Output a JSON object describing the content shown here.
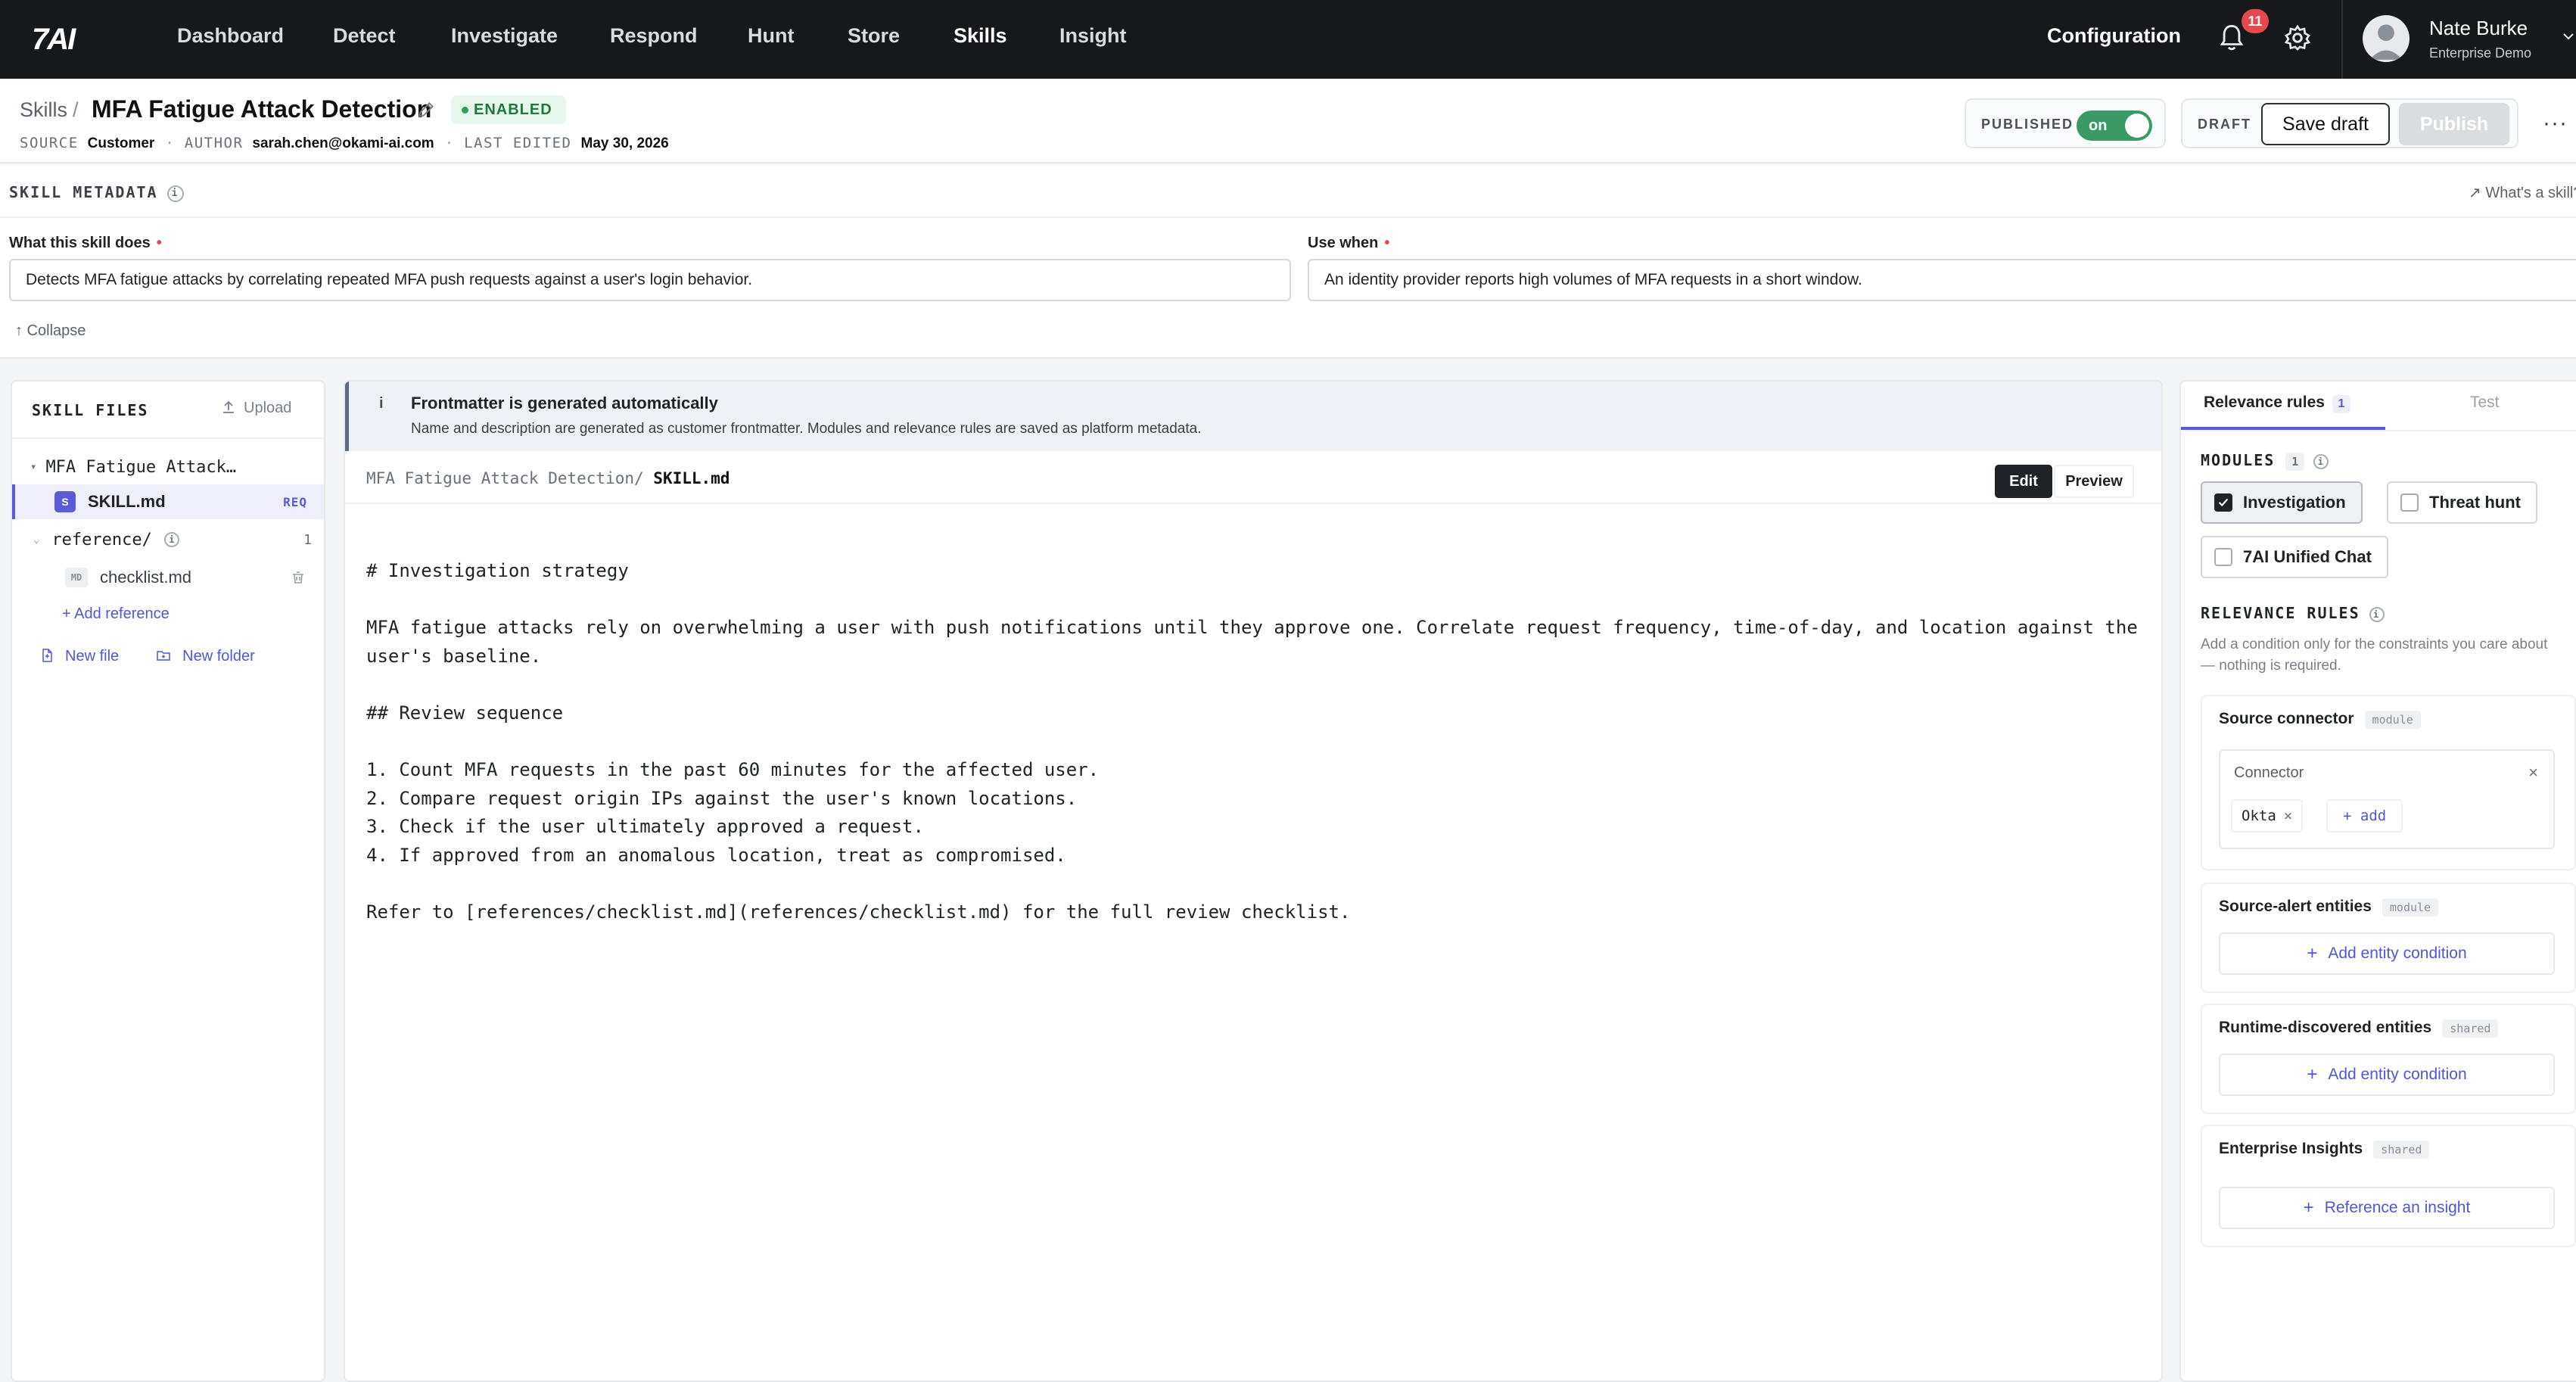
{
  "nav": {
    "logo": "7AI",
    "items": [
      "Dashboard",
      "Detect",
      "Investigate",
      "Respond",
      "Hunt",
      "Store",
      "Skills",
      "Insight"
    ],
    "active": "Skills",
    "configuration": "Configuration",
    "notifications_count": "11",
    "user_name": "Nate Burke",
    "user_org": "Enterprise Demo"
  },
  "header": {
    "breadcrumb_root": "Skills",
    "breadcrumb_sep": "/",
    "title": "MFA Fatigue Attack Detection",
    "status": "ENABLED",
    "source_label": "SOURCE",
    "source_value": "Customer",
    "author_label": "AUTHOR",
    "author_value": "sarah.chen@okami-ai.com",
    "edited_label": "LAST EDITED",
    "edited_value": "May 30, 2026",
    "published_label": "PUBLISHED",
    "toggle_text": "on",
    "draft_label": "DRAFT",
    "save_draft": "Save draft",
    "publish": "Publish",
    "more": "···"
  },
  "metadata": {
    "title": "SKILL METADATA",
    "help_link": "↗ What's a skill?",
    "what_label": "What this skill does",
    "what_value": "Detects MFA fatigue attacks by correlating repeated MFA push requests against a user's login behavior.",
    "use_label": "Use when",
    "use_value": "An identity provider reports high volumes of MFA requests in a short window.",
    "collapse": "↑ Collapse"
  },
  "files": {
    "title": "SKILL FILES",
    "upload": "Upload",
    "root_folder": "MFA Fatigue Attack…",
    "skill_file": "SKILL.md",
    "skill_badge": "S",
    "req_tag": "REQ",
    "ref_folder": "reference/",
    "ref_count": "1",
    "ref_file": "checklist.md",
    "md_badge": "MD",
    "add_reference": "+ Add reference",
    "new_file": "New file",
    "new_folder": "New folder"
  },
  "editor": {
    "banner_icon": "i",
    "banner_title": "Frontmatter is generated automatically",
    "banner_text": "Name and description are generated as customer frontmatter. Modules and relevance rules are saved as platform metadata.",
    "path_prefix": "MFA Fatigue Attack Detection/ ",
    "path_file": "SKILL.md",
    "edit_label": "Edit",
    "preview_label": "Preview",
    "content": "# Investigation strategy\n\nMFA fatigue attacks rely on overwhelming a user with push notifications until they approve one. Correlate request frequency, time-of-day, and location against the\nuser's baseline.\n\n## Review sequence\n\n1. Count MFA requests in the past 60 minutes for the affected user.\n2. Compare request origin IPs against the user's known locations.\n3. Check if the user ultimately approved a request.\n4. If approved from an anomalous location, treat as compromised.\n\nRefer to [references/checklist.md](references/checklist.md) for the full review checklist."
  },
  "rules": {
    "tab_relevance": "Relevance rules",
    "tab_relevance_count": "1",
    "tab_test": "Test",
    "modules_title": "MODULES",
    "modules_count": "1",
    "module_investigation": "Investigation",
    "module_threat_hunt": "Threat hunt",
    "module_unified_chat": "7AI Unified Chat",
    "relevance_title": "RELEVANCE RULES",
    "relevance_sub": "Add a condition only for the constraints you care about — nothing is required.",
    "source_connector": "Source connector",
    "tag_module": "module",
    "tag_shared": "shared",
    "connector_label": "Connector",
    "connector_value": "Okta",
    "connector_add": "+ add",
    "source_alert_entities": "Source-alert entities",
    "runtime_entities": "Runtime-discovered entities",
    "enterprise_insights": "Enterprise Insights",
    "add_entity": "Add entity condition",
    "reference_insight": "Reference an insight"
  },
  "colors": {
    "nav_bg": "#16181c",
    "accent": "#5b5bd6",
    "enabled_green": "#1e7a3c",
    "toggle_green": "#3a9a66",
    "alert_red": "#e5484d"
  }
}
